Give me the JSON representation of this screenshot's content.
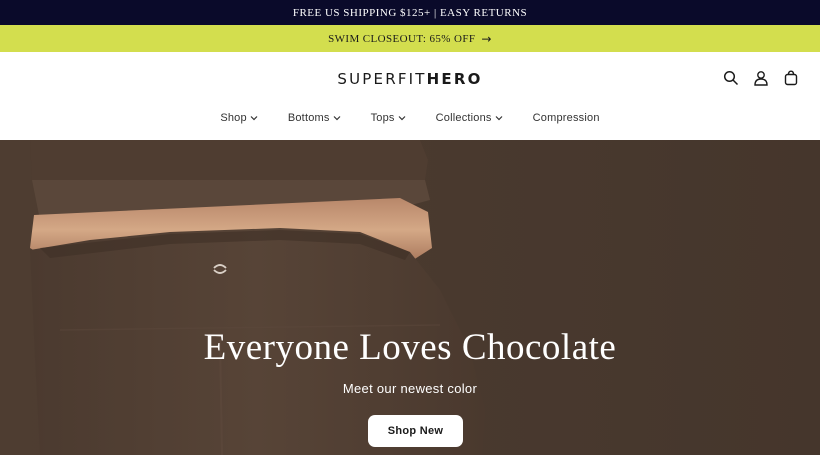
{
  "announcement": {
    "text": "FREE US SHIPPING $125+  | EASY RETURNS"
  },
  "promo": {
    "text": "SWIM CLOSEOUT: 65% OFF",
    "arrow": "→"
  },
  "header": {
    "logo_light": "SUPERFIT",
    "logo_bold": "HERO",
    "icons": [
      "search-icon",
      "account-icon",
      "cart-icon"
    ]
  },
  "nav": {
    "items": [
      {
        "label": "Shop",
        "has_dropdown": true
      },
      {
        "label": "Bottoms",
        "has_dropdown": true
      },
      {
        "label": "Tops",
        "has_dropdown": true
      },
      {
        "label": "Collections",
        "has_dropdown": true
      },
      {
        "label": "Compression",
        "has_dropdown": false
      }
    ]
  },
  "hero": {
    "title": "Everyone Loves Chocolate",
    "subtitle": "Meet our newest color",
    "button_label": "Shop New"
  },
  "colors": {
    "announcement_bg": "#0a0a2a",
    "promo_bg": "#d3de4e",
    "hero_bg": "#4a3a2f",
    "skin": "#c89a78"
  }
}
